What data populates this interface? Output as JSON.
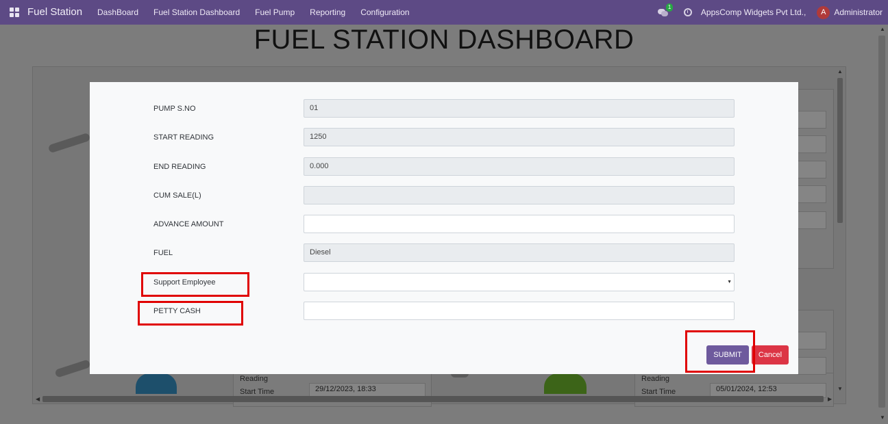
{
  "navbar": {
    "app_name": "Fuel Station",
    "menu": [
      "DashBoard",
      "Fuel Station Dashboard",
      "Fuel Pump",
      "Reporting",
      "Configuration"
    ],
    "message_count": "1",
    "company": "AppsComp Widgets Pvt Ltd.,",
    "avatar_letter": "A",
    "user": "Administrator"
  },
  "page": {
    "title": "FUEL STATION DASHBOARD"
  },
  "background": {
    "reading_label_left": "Reading",
    "start_time_label_left": "Start Time",
    "start_time_left": "29/12/2023, 18:33",
    "reading_label_right": "Reading",
    "start_time_label_right": "Start Time",
    "start_time_right": "05/01/2024, 12:53"
  },
  "modal": {
    "fields": {
      "pump_sno": {
        "label": "PUMP S.NO",
        "value": "01"
      },
      "start_reading": {
        "label": "START READING",
        "value": "1250"
      },
      "end_reading": {
        "label": "END READING",
        "value": "0.000"
      },
      "cum_sale": {
        "label": "CUM SALE(L)",
        "value": ""
      },
      "advance_amount": {
        "label": "ADVANCE AMOUNT",
        "value": ""
      },
      "fuel": {
        "label": "FUEL",
        "value": "Diesel"
      },
      "support_employee": {
        "label": "Support Employee",
        "value": ""
      },
      "petty_cash": {
        "label": "PETTY CASH",
        "value": ""
      }
    },
    "submit_label": "SUBMIT",
    "cancel_label": "Cancel"
  },
  "colors": {
    "navbar": "#5d4a85",
    "submit": "#6e5a9d",
    "cancel": "#dc3545",
    "highlight": "#e00000"
  }
}
